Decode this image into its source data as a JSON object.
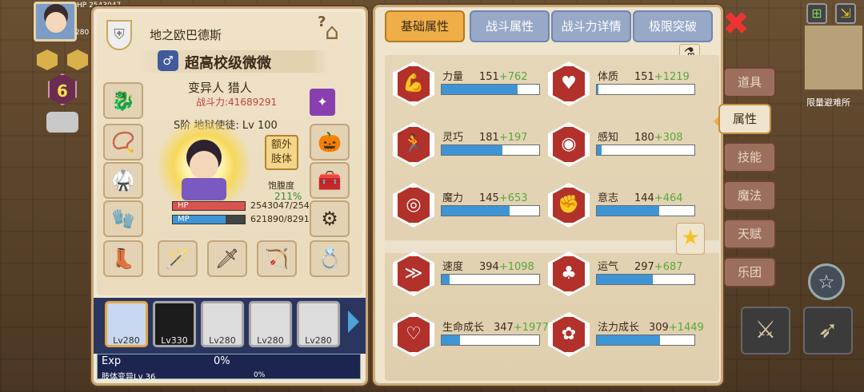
{
  "left_panel": {
    "realm_name": "地之欧巴德斯",
    "help_icon": "question-icon",
    "title": "超高校级微微",
    "gender_symbol": "♂",
    "class": "变异人 猎人",
    "power": "战斗力:41689291",
    "rank": "S阶 地狱使徒: Lv 100",
    "extra_button": [
      "额外",
      "肢体"
    ],
    "hunger_label": "饱腹度",
    "hunger_value": "211%",
    "hp_label": "HP",
    "hp_value": "2543047/254",
    "hp_fraction": 1.0,
    "mp_label": "MP",
    "mp_value": "621890/8291",
    "mp_fraction": 0.73,
    "characters": [
      {
        "level": "Lv280",
        "selected": true
      },
      {
        "level": "Lv330",
        "selected": false
      },
      {
        "level": "Lv280",
        "selected": false
      },
      {
        "level": "Lv280",
        "selected": false
      },
      {
        "level": "Lv280",
        "selected": false
      }
    ],
    "exp_label": "Exp",
    "exp_value": "0%",
    "sub_exp_label": "肢体变异Lv 36",
    "sub_exp_value": "0%"
  },
  "hud": {
    "level_badge": "6",
    "hp_prefix": "HP",
    "hp_number": "2543047",
    "small_num": "280"
  },
  "tabs": [
    "基础属性",
    "战斗属性",
    "战斗力详情",
    "极限突破"
  ],
  "active_tab": 0,
  "stats": [
    {
      "name": "力量",
      "base": "151",
      "bonus": "+762",
      "fill": 0.78,
      "icon": "muscle-icon"
    },
    {
      "name": "体质",
      "base": "151",
      "bonus": "+1219",
      "fill": 0.02,
      "icon": "body-icon"
    },
    {
      "name": "灵巧",
      "base": "181",
      "bonus": "+197",
      "fill": 0.62,
      "icon": "running-icon"
    },
    {
      "name": "感知",
      "base": "180",
      "bonus": "+308",
      "fill": 0.05,
      "icon": "eye-icon"
    },
    {
      "name": "魔力",
      "base": "145",
      "bonus": "+653",
      "fill": 0.7,
      "icon": "magic-swirl-icon"
    },
    {
      "name": "意志",
      "base": "144",
      "bonus": "+464",
      "fill": 0.64,
      "icon": "will-icon"
    },
    {
      "name": "速度",
      "base": "394",
      "bonus": "+1098",
      "fill": 0.08,
      "icon": "speed-icon"
    },
    {
      "name": "运气",
      "base": "297",
      "bonus": "+687",
      "fill": 0.57,
      "icon": "clover-icon"
    },
    {
      "name": "生命成长",
      "base": "347",
      "bonus": "+1977",
      "fill": 0.19,
      "icon": "heart-icon"
    },
    {
      "name": "法力成长",
      "base": "309",
      "bonus": "+1449",
      "fill": 0.65,
      "icon": "mana-icon"
    }
  ],
  "side_tabs": [
    "道具",
    "属性",
    "技能",
    "魔法",
    "天赋",
    "乐团"
  ],
  "active_side_tab": 1,
  "map_label": "限量避难所",
  "colors": {
    "accent": "#efae48",
    "bar": "#3e95d6",
    "bonus": "#5aa83a",
    "power": "#c2433d",
    "hp": "#d9534f",
    "mp": "#3e95d6"
  }
}
